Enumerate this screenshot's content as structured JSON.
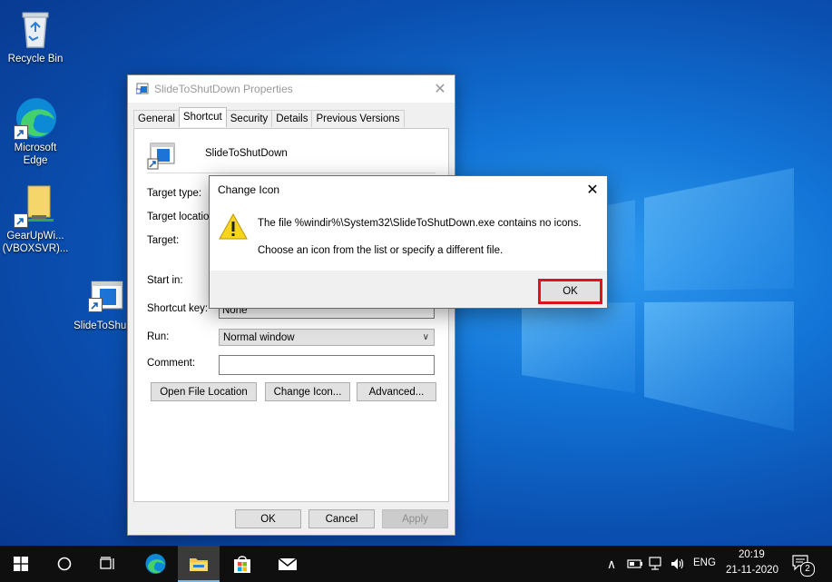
{
  "desktop": {
    "icons": [
      {
        "label": "Recycle Bin"
      },
      {
        "label_line1": "Microsoft",
        "label_line2": "Edge"
      },
      {
        "label_line1": "GearUpWi...",
        "label_line2": "(VBOXSVR)..."
      },
      {
        "label": "SlideToShu..."
      }
    ]
  },
  "properties_dialog": {
    "title": "SlideToShutDown Properties",
    "tabs": [
      "General",
      "Shortcut",
      "Security",
      "Details",
      "Previous Versions"
    ],
    "active_tab": "Shortcut",
    "shortcut_name": "SlideToShutDown",
    "labels": {
      "target_type": "Target type:",
      "target_location": "Target location",
      "target": "Target:",
      "start_in": "Start in:",
      "shortcut_key": "Shortcut key:",
      "run": "Run:",
      "comment": "Comment:"
    },
    "values": {
      "shortcut_key": "None",
      "run": "Normal window",
      "comment": ""
    },
    "buttons": {
      "open_file_location": "Open File Location",
      "change_icon": "Change Icon...",
      "advanced": "Advanced...",
      "ok": "OK",
      "cancel": "Cancel",
      "apply": "Apply"
    }
  },
  "change_icon_dialog": {
    "title": "Change Icon",
    "message_line1": "The file %windir%\\System32\\SlideToShutDown.exe contains no icons.",
    "message_line2": "Choose an icon from the list or specify a different file.",
    "ok_label": "OK",
    "highlight_color": "#e0131d"
  },
  "taskbar": {
    "language": "ENG",
    "time": "20:19",
    "date": "21-11-2020",
    "notification_count": "2"
  }
}
